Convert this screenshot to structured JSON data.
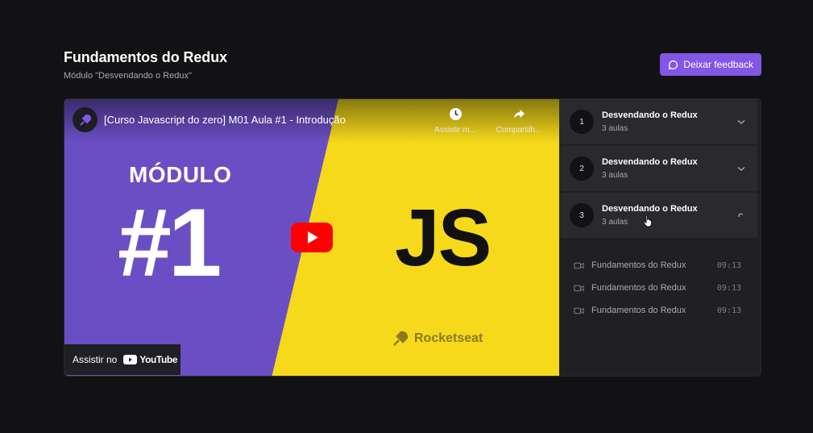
{
  "header": {
    "title": "Fundamentos do Redux",
    "subtitle": "Módulo \"Desvendando o Redux\"",
    "feedback_label": "Deixar feedback"
  },
  "video": {
    "title": "[Curso Javascript do zero] M01 Aula #1 - Introdução",
    "watch_later_label": "Assistir m...",
    "share_label": "Compartilh...",
    "thumbnail": {
      "module_label": "MÓDULO",
      "module_number": "#1",
      "language": "JS",
      "brand": "Rocketseat"
    },
    "watch_on_label": "Assistir no",
    "youtube_label": "YouTube",
    "colors": {
      "purple": "#6a4fc4",
      "yellow": "#f5d91a",
      "youtube_red": "#ff0000"
    }
  },
  "modules": [
    {
      "number": "1",
      "title": "Desvendando o Redux",
      "count": "3 aulas",
      "expanded": false
    },
    {
      "number": "2",
      "title": "Desvendando o Redux",
      "count": "3 aulas",
      "expanded": false
    },
    {
      "number": "3",
      "title": "Desvendando o Redux",
      "count": "3 aulas",
      "expanded": true
    }
  ],
  "lessons": [
    {
      "title": "Fundamentos do Redux",
      "duration": "09:13"
    },
    {
      "title": "Fundamentos do Redux",
      "duration": "09:13"
    },
    {
      "title": "Fundamentos do Redux",
      "duration": "09:13"
    }
  ],
  "colors": {
    "accent": "#8257e5",
    "background": "#121214",
    "panel": "#29292e"
  }
}
